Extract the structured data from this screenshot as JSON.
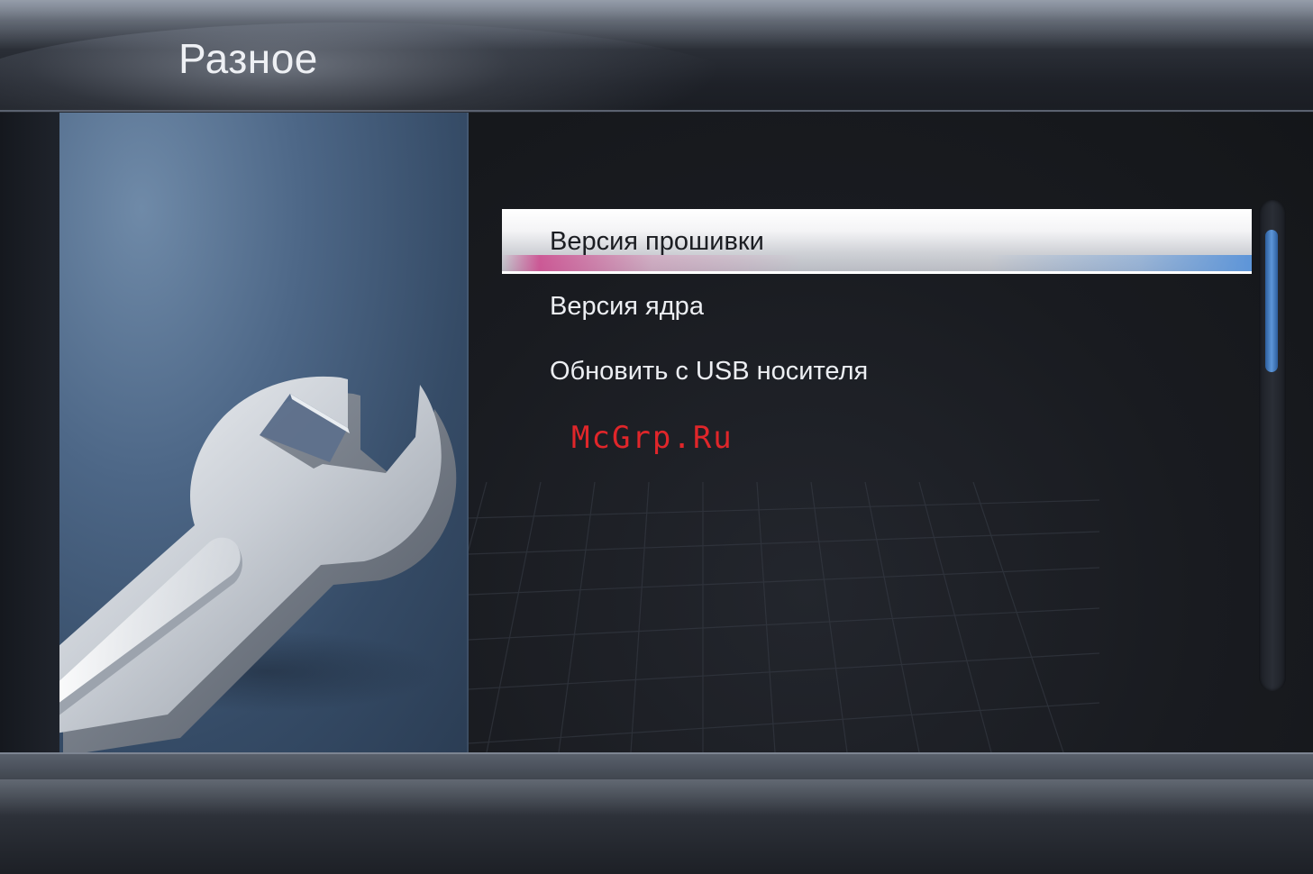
{
  "header": {
    "title": "Разное"
  },
  "menu": {
    "items": [
      {
        "label": "Версия прошивки",
        "selected": true
      },
      {
        "label": "Версия ядра",
        "selected": false
      },
      {
        "label": "Обновить с USB носителя",
        "selected": false
      }
    ]
  },
  "scrollbar": {
    "visible_fraction": 0.29,
    "position": 0
  },
  "watermark": {
    "text": "McGrp.Ru"
  },
  "icons": {
    "section_icon": "wrench-icon"
  },
  "colors": {
    "accent_blue": "#5d95d8",
    "accent_pink": "#cd468c",
    "panel_blue": "#4d6787",
    "watermark_red": "#e0262a"
  }
}
